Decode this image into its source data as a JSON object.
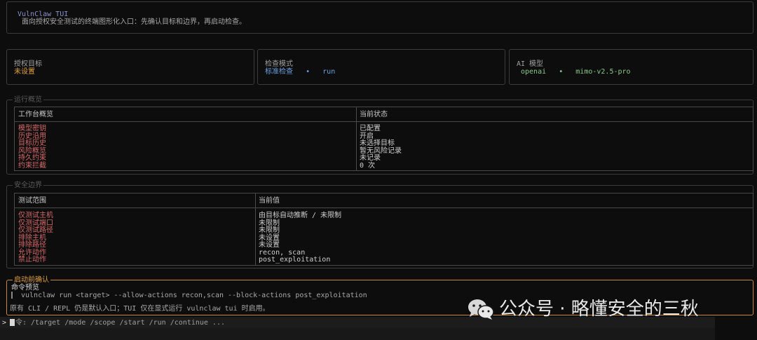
{
  "header": {
    "title": "VulnClaw TUI",
    "subtitle": "面向授权安全测试的终端图形化入口：先确认目标和边界，再启动检查。"
  },
  "cards": {
    "target": {
      "label": "授权目标",
      "value": "未设置"
    },
    "mode": {
      "label": "检查模式",
      "value": "标准检查",
      "sep": "•",
      "extra": "run"
    },
    "model": {
      "label": "AI 模型",
      "provider": "openai",
      "sep": "•",
      "name": "mimo-v2.5-pro"
    }
  },
  "overview": {
    "legend": "运行概览",
    "col1": "工作台概览",
    "col2": "当前状态",
    "rows": [
      {
        "k": "模型密钥",
        "v": "已配置"
      },
      {
        "k": "历史沿用",
        "v": "开启"
      },
      {
        "k": "目标历史",
        "v": "未选择目标"
      },
      {
        "k": "风险概览",
        "v": "暂无风险记录"
      },
      {
        "k": "持久约束",
        "v": "未记录"
      },
      {
        "k": "约束拦截",
        "v": "0 次"
      }
    ]
  },
  "boundary": {
    "legend": "安全边界",
    "col1": "测试范围",
    "col2": "当前值",
    "rows": [
      {
        "k": "仅测试主机",
        "v": "由目标自动推断 / 未限制"
      },
      {
        "k": "仅测试端口",
        "v": "未限制"
      },
      {
        "k": "仅测试路径",
        "v": "未限制"
      },
      {
        "k": "排除主机",
        "v": "未设置"
      },
      {
        "k": "排除路径",
        "v": "未设置"
      },
      {
        "k": "允许动作",
        "v": "recon, scan"
      },
      {
        "k": "禁止动作",
        "v": "post_exploitation"
      }
    ]
  },
  "confirm": {
    "legend": "启动前确认",
    "preview_label": "命令预览",
    "command": "vulnclaw run <target> --allow-actions recon,scan --block-actions post_exploitation",
    "note": "原有 CLI / REPL 仍是默认入口；TUI 仅在显式运行 vulnclaw tui 时启用。"
  },
  "prompt": {
    "arrow": ">",
    "tail": "令: /target /mode /scope /start /run /continue ..."
  },
  "watermark": {
    "text": "公众号 · 略懂安全的三秋"
  },
  "colors": {
    "accent_orange": "#e0a040",
    "accent_blue": "#6aa0e0",
    "accent_green": "#8ac88a",
    "row_key_red": "#d86a6a",
    "title_purple": "#8a92c8"
  }
}
